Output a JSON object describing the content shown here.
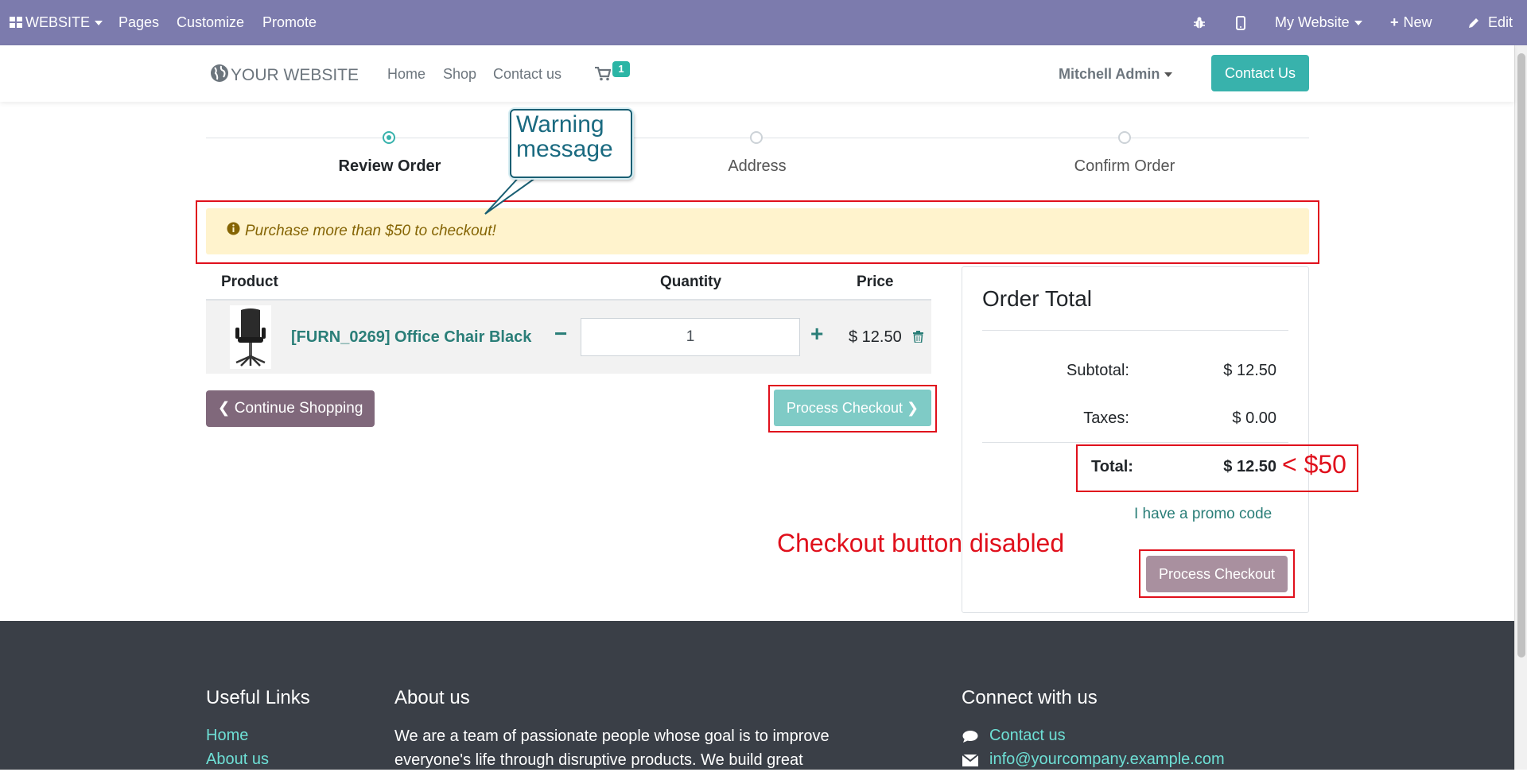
{
  "admin_bar": {
    "website_label": "WEBSITE",
    "pages": "Pages",
    "customize": "Customize",
    "promote": "Promote",
    "site_selector": "My Website",
    "new": "New",
    "edit": "Edit"
  },
  "header": {
    "logo_text": "YOUR WEBSITE",
    "nav": [
      "Home",
      "Shop",
      "Contact us"
    ],
    "cart_count": "1",
    "user": "Mitchell Admin",
    "contact_button": "Contact Us"
  },
  "steps": [
    {
      "label": "Review Order",
      "active": true
    },
    {
      "label": "Address",
      "active": false
    },
    {
      "label": "Confirm Order",
      "active": false
    }
  ],
  "warning": "Purchase more than $50 to checkout!",
  "cart": {
    "columns": [
      "Product",
      "Quantity",
      "Price"
    ],
    "items": [
      {
        "name": "[FURN_0269] Office Chair Black",
        "quantity": "1",
        "price": "$ 12.50"
      }
    ],
    "continue_button": "Continue Shopping",
    "checkout_button": "Process Checkout"
  },
  "order_total": {
    "title": "Order Total",
    "subtotal_label": "Subtotal:",
    "subtotal_value": "$ 12.50",
    "taxes_label": "Taxes:",
    "taxes_value": "$ 0.00",
    "total_label": "Total:",
    "total_value": "$ 12.50",
    "promo_link": "I have a promo code",
    "checkout_button": "Process Checkout"
  },
  "annotations": {
    "callout": "Warning message",
    "less_than": "< $50",
    "disabled_note": "Checkout button disabled"
  },
  "footer": {
    "useful_links_title": "Useful Links",
    "useful_links": [
      "Home",
      "About us"
    ],
    "about_title": "About us",
    "about_text": "We are a team of passionate people whose goal is to improve everyone's life through disruptive products. We build great",
    "connect_title": "Connect with us",
    "contact_link": "Contact us",
    "email_link": "info@yourcompany.example.com"
  },
  "colors": {
    "admin_bar": "#7c7bad",
    "accent": "#38b2ac",
    "warning_bg": "#fff3cd",
    "annotation_red": "#e0101c",
    "footer_bg": "#3a3f47"
  }
}
